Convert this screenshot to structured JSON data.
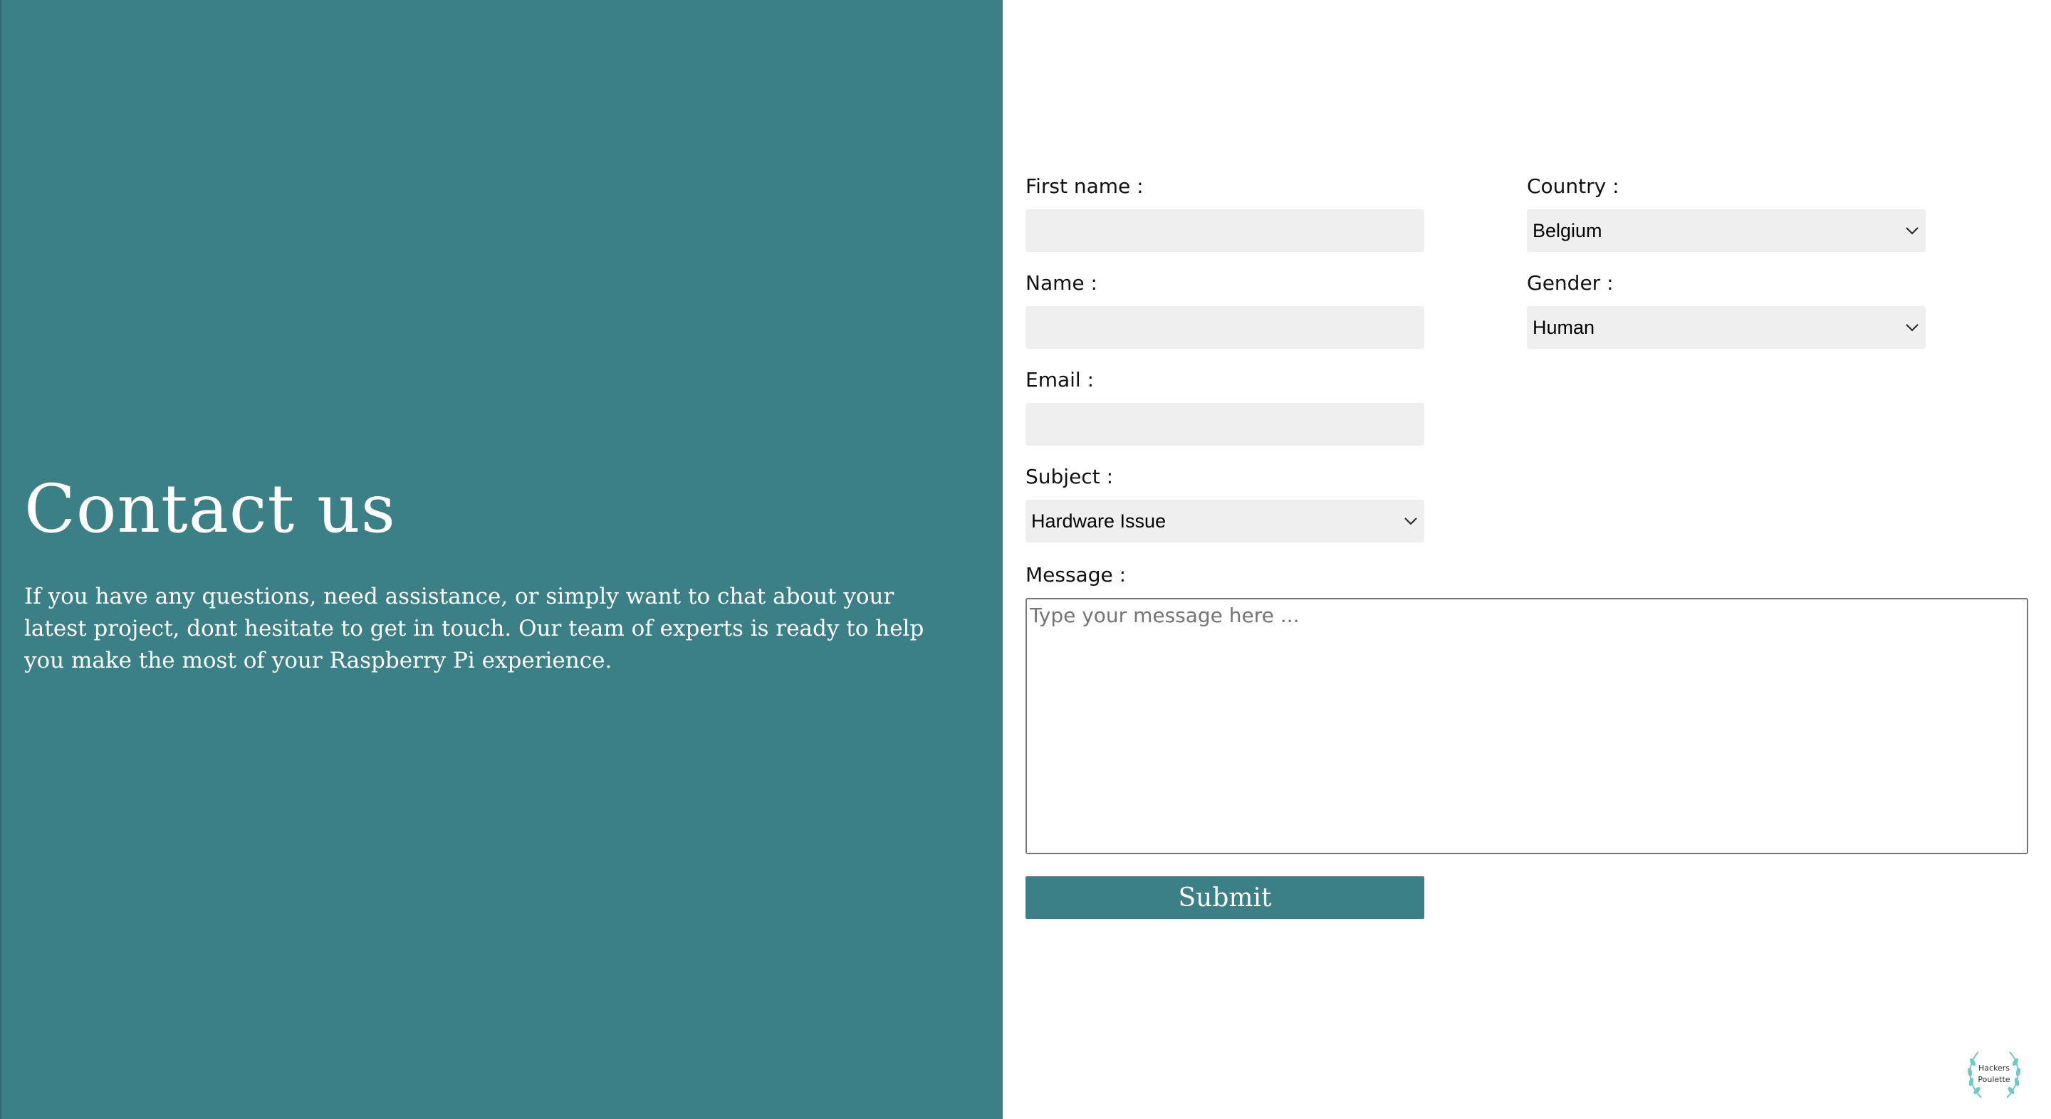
{
  "hero": {
    "title": "Contact us",
    "text": "If you have any questions, need assistance, or simply want to chat about your latest project, dont hesitate to get in touch. Our team of experts is ready to help you make the most of your Raspberry Pi experience."
  },
  "form": {
    "first_name": {
      "label": "First name :",
      "value": ""
    },
    "name": {
      "label": "Name :",
      "value": ""
    },
    "email": {
      "label": "Email :",
      "value": ""
    },
    "subject": {
      "label": "Subject :",
      "selected": "Hardware Issue"
    },
    "country": {
      "label": "Country :",
      "selected": "Belgium"
    },
    "gender": {
      "label": "Gender :",
      "selected": "Human"
    },
    "message": {
      "label": "Message :",
      "placeholder": "Type your message here ...",
      "value": ""
    },
    "submit_label": "Submit"
  },
  "logo": {
    "line1": "Hackers",
    "line2": "Poulette"
  },
  "colors": {
    "accent": "#3b8086",
    "input_bg": "#efefef"
  },
  "icons": {
    "select_chevron": "chevron-down-icon",
    "logo": "laurel-wreath-icon"
  }
}
